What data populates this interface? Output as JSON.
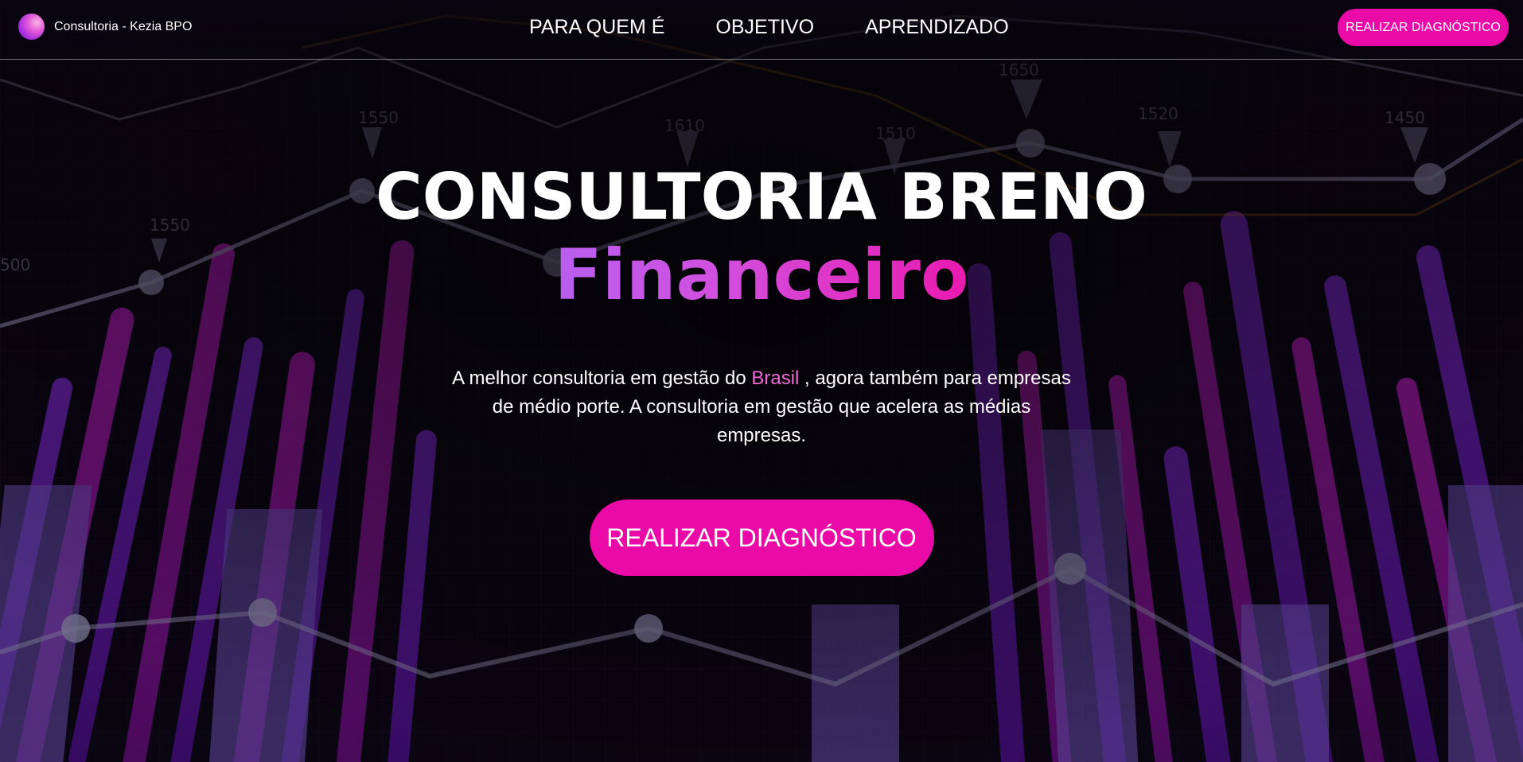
{
  "nav": {
    "brand_name": "Consultoria - Kezia BPO",
    "links": [
      "PARA QUEM É",
      "OBJETIVO",
      "APRENDIZADO"
    ],
    "cta_label": "REALIZAR DIAGNÓSTICO"
  },
  "hero": {
    "title": "CONSULTORIA BRENO",
    "subtitle": "Financeiro",
    "text_before": "A melhor consultoria em gestão do ",
    "text_highlight": "Brasil",
    "text_after": " , agora também para empresas de médio porte. A consultoria em gestão que acelera as médias empresas.",
    "cta_label": "REALIZAR DIAGNÓSTICO"
  },
  "background": {
    "chart_labels": [
      "500",
      "1550",
      "1550",
      "1610",
      "1510",
      "1650",
      "1520",
      "1450"
    ]
  },
  "colors": {
    "accent": "#ea0aa7",
    "highlight": "#f06ad6",
    "background": "#07040d",
    "purple": "#8a2be2"
  }
}
